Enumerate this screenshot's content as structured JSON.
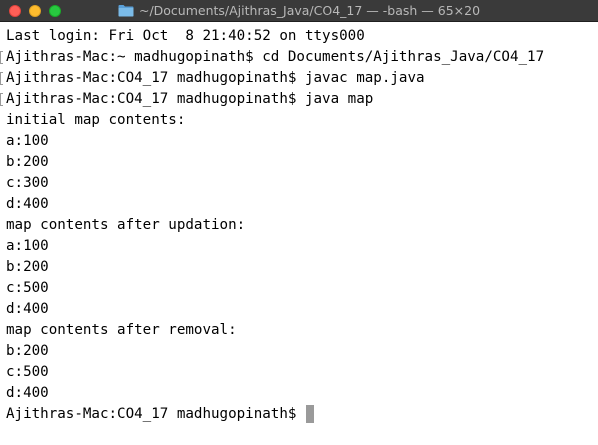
{
  "window": {
    "title": "~/Documents/Ajithras_Java/CO4_17 — -bash — 65×20",
    "folder_icon": "folder-icon",
    "colors": {
      "titlebar": "#3a3a3a",
      "close": "#ff5f57",
      "minimize": "#febc2e",
      "maximize": "#28c840",
      "cursor": "#9a9a9a"
    }
  },
  "terminal": {
    "lines": [
      "Last login: Fri Oct  8 21:40:52 on ttys000",
      "Ajithras-Mac:~ madhugopinath$ cd Documents/Ajithras_Java/CO4_17",
      "Ajithras-Mac:CO4_17 madhugopinath$ javac map.java",
      "Ajithras-Mac:CO4_17 madhugopinath$ java map",
      "initial map contents:",
      "a:100",
      "b:200",
      "c:300",
      "d:400",
      "map contents after updation:",
      "a:100",
      "b:200",
      "c:500",
      "d:400",
      "map contents after removal:",
      "b:200",
      "c:500",
      "d:400"
    ],
    "current_prompt": "Ajithras-Mac:CO4_17 madhugopinath$ "
  }
}
